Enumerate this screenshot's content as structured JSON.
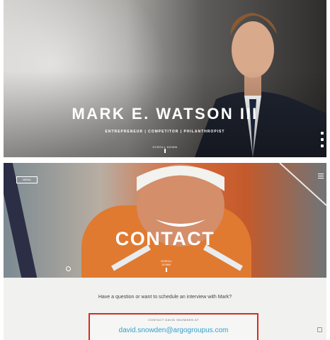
{
  "hero": {
    "name": "MARK E. WATSON III",
    "tagline": "ENTREPRENEUR  |  COMPETITOR  |  PHILANTHROPIST",
    "scroll_label": "SCROLL DOWN"
  },
  "contact": {
    "title": "CONTACT",
    "tag_label": "MENU",
    "scroll_label": "SCROLL DOWN"
  },
  "info": {
    "question": "Have a question or want to schedule an interview with Mark?",
    "email_heading": "CONTACT DAVID SNOWDEN AT",
    "email": "david.snowden@argogroupus.com"
  },
  "colors": {
    "accent_red": "#d92a1f",
    "link_blue": "#2fa0cf",
    "vest_orange": "#e07a30"
  }
}
